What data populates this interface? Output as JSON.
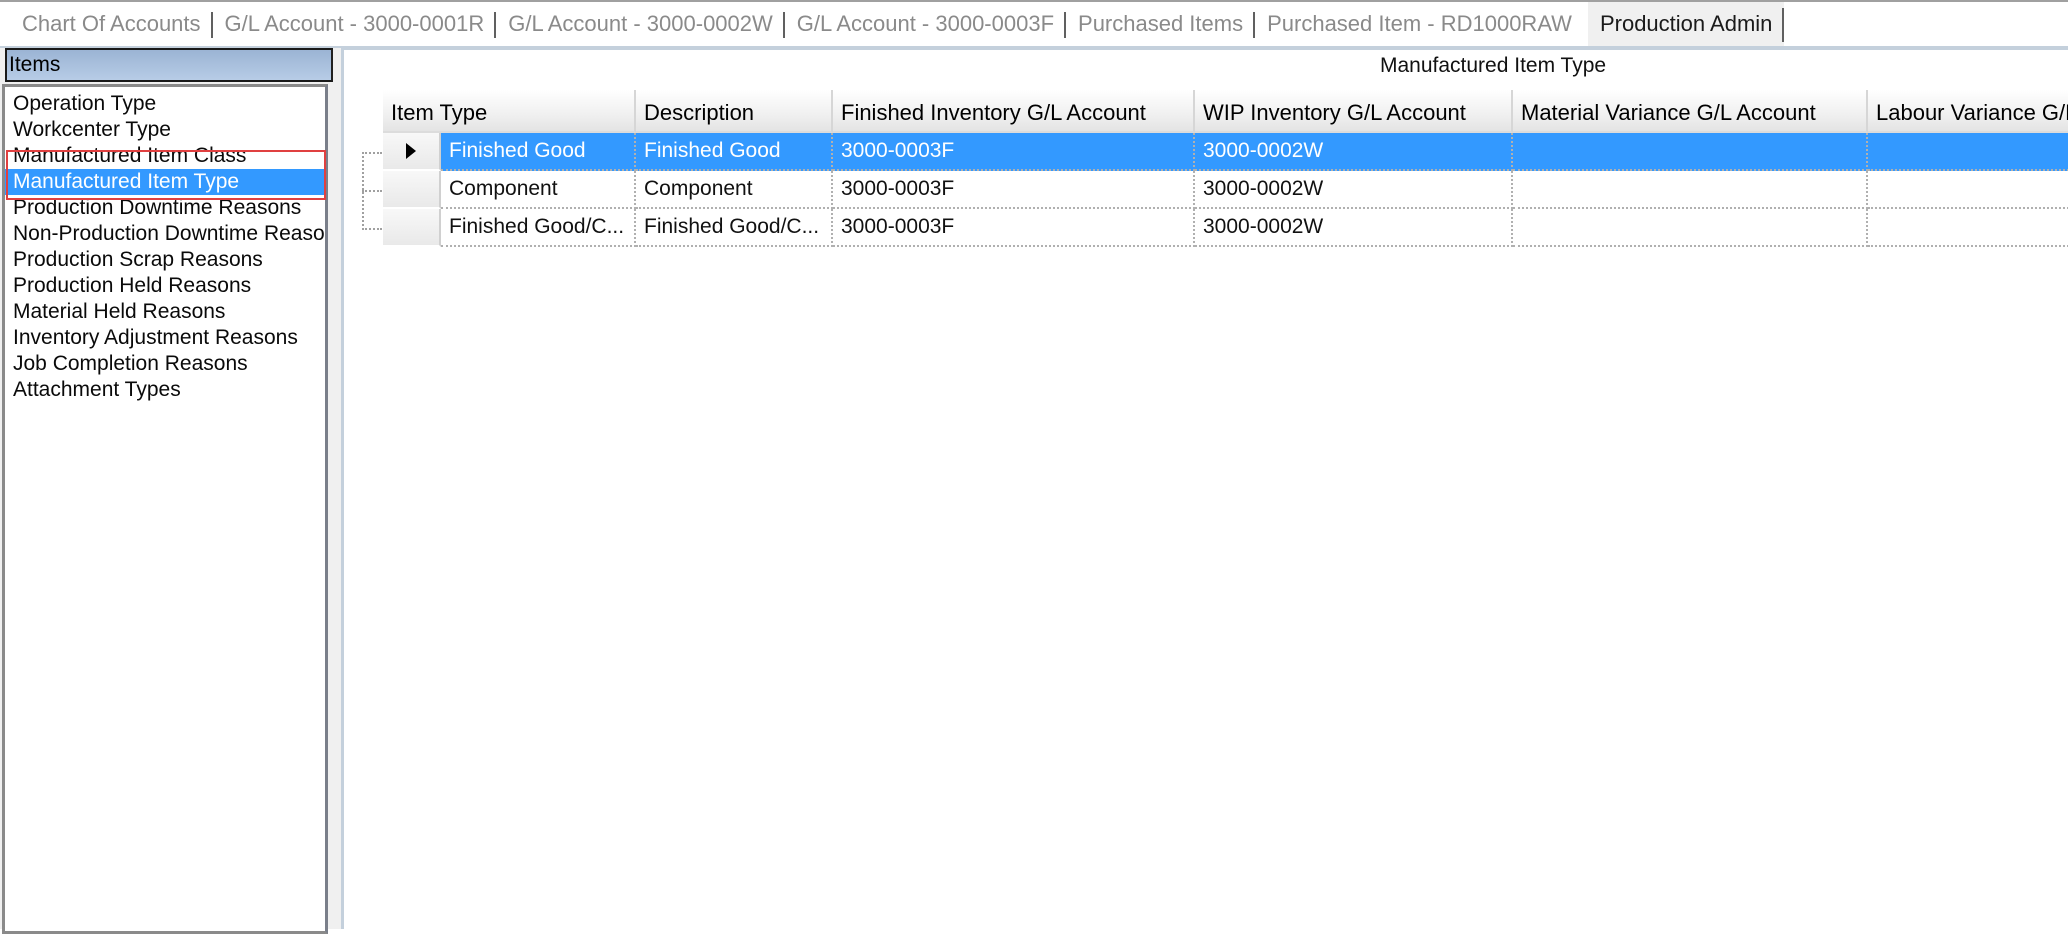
{
  "tabs": [
    {
      "label": "Chart Of Accounts",
      "active": false
    },
    {
      "label": "G/L Account - 3000-0001R",
      "active": false
    },
    {
      "label": "G/L Account - 3000-0002W",
      "active": false
    },
    {
      "label": "G/L Account - 3000-0003F",
      "active": false
    },
    {
      "label": "Purchased Items",
      "active": false
    },
    {
      "label": "Purchased Item - RD1000RAW",
      "active": false
    },
    {
      "label": "Production Admin",
      "active": true
    }
  ],
  "sidebar": {
    "header": "Items",
    "items": [
      {
        "label": "Operation Type"
      },
      {
        "label": "Workcenter Type"
      },
      {
        "label": "Manufactured Item Class"
      },
      {
        "label": "Manufactured Item Type",
        "selected": true
      },
      {
        "label": "Production Downtime Reasons"
      },
      {
        "label": "Non-Production Downtime Reaso"
      },
      {
        "label": "Production Scrap Reasons"
      },
      {
        "label": "Production Held Reasons"
      },
      {
        "label": "Material Held Reasons"
      },
      {
        "label": "Inventory Adjustment Reasons"
      },
      {
        "label": "Job Completion Reasons"
      },
      {
        "label": "Attachment Types"
      }
    ]
  },
  "grid": {
    "title": "Manufactured Item Type",
    "columns": [
      "Item Type",
      "Description",
      "Finished Inventory G/L Account",
      "WIP Inventory G/L Account",
      "Material Variance G/L Account",
      "Labour Variance G/L"
    ],
    "rows": [
      {
        "selected": true,
        "cells": [
          "Finished Good",
          "Finished Good",
          "3000-0003F",
          "3000-0002W",
          "",
          ""
        ]
      },
      {
        "selected": false,
        "cells": [
          "Component",
          "Component",
          "3000-0003F",
          "3000-0002W",
          "",
          ""
        ]
      },
      {
        "selected": false,
        "cells": [
          "Finished Good/C...",
          "Finished Good/C...",
          "3000-0003F",
          "3000-0002W",
          "",
          ""
        ]
      }
    ]
  },
  "colors": {
    "selection": "#3399ff",
    "highlight_box": "#e04040"
  }
}
